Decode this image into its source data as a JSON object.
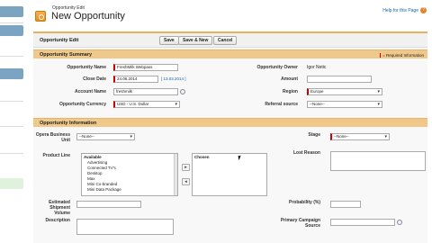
{
  "header": {
    "breadcrumb": "Opportunity Edit",
    "title": "New Opportunity",
    "help_link": "Help for this Page",
    "help_icon": "help-icon"
  },
  "toolbar": {
    "section_title": "Opportunity Edit",
    "save_label": "Save",
    "save_new_label": "Save & New",
    "cancel_label": "Cancel"
  },
  "summary": {
    "title": "Opportunity Summary",
    "required_info": "= Required Information",
    "name_label": "Opportunity Name",
    "name_value": "FreshMilk Webpass",
    "close_date_label": "Close Date",
    "close_date_value": "24.06.2014",
    "close_date_link": "[ 13.03.2014 ]",
    "account_label": "Account Name",
    "account_value": "freshmilk",
    "currency_label": "Opportunity Currency",
    "currency_value": "USD - U.S. Dollar",
    "owner_label": "Opportunity Owner",
    "owner_value": "Igor Netic",
    "amount_label": "Amount",
    "amount_value": "",
    "region_label": "Region",
    "region_value": "Europe",
    "referral_label": "Referral source",
    "referral_value": "--None--"
  },
  "information": {
    "title": "Opportunity Information",
    "opera_label": "Opera Business Unit",
    "opera_value": "--None--",
    "product_line_label": "Product Line",
    "available_header": "Available",
    "available_options": [
      "Advertising",
      "Connected TV's",
      "Desktop",
      "Max",
      "Mini Co-branded",
      "Mini Data Package"
    ],
    "chosen_header": "Chosen",
    "add_arrow": "▸",
    "remove_arrow": "◂",
    "stage_label": "Stage",
    "stage_value": "--None--",
    "lost_reason_label": "Lost Reason",
    "shipment_label": "Estimated Shipment Volume",
    "shipment_value": "",
    "probability_label": "Probability (%)",
    "probability_value": "",
    "description_label": "Description",
    "campaign_label": "Primary Campaign Source",
    "campaign_value": ""
  },
  "colors": {
    "section_header": "#f0c98a",
    "accent": "#e9b15a",
    "link": "#1b5fa8",
    "required": "#cc0000"
  }
}
